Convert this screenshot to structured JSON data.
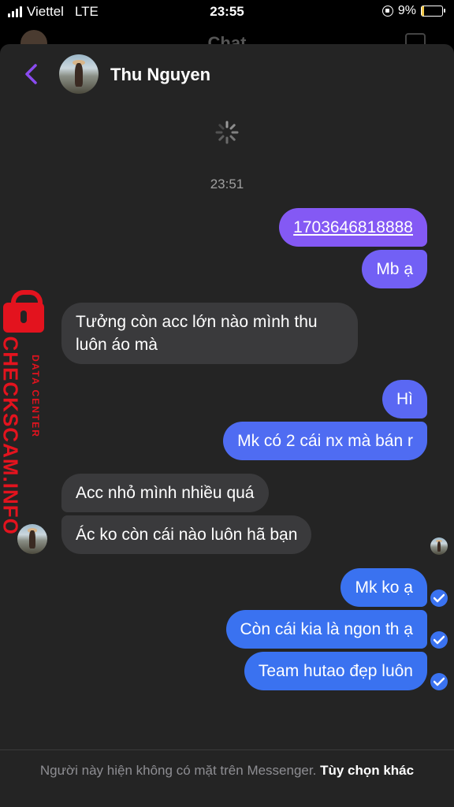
{
  "status_bar": {
    "carrier": "Viettel",
    "network": "LTE",
    "time": "23:55",
    "battery": "9%"
  },
  "underlying": {
    "title": "Chat"
  },
  "header": {
    "contact_name": "Thu Nguyen"
  },
  "conversation": {
    "timestamp": "23:51",
    "messages": [
      {
        "from": "me",
        "text": "1703646818888",
        "link": true
      },
      {
        "from": "me",
        "text": "Mb ạ"
      },
      {
        "from": "them",
        "text_line1": "Tưởng còn acc lớn nào mình thu",
        "text_line2": "luôn áo mà"
      },
      {
        "from": "me",
        "text": "Hì"
      },
      {
        "from": "me",
        "text": "Mk có 2 cái nx mà bán r"
      },
      {
        "from": "them",
        "text": "Acc nhỏ mình nhiều quá"
      },
      {
        "from": "them",
        "text": "Ác ko còn cái nào luôn hã bạn"
      },
      {
        "from": "me",
        "text": "Mk ko ạ"
      },
      {
        "from": "me",
        "text": "Còn cái kia là ngon th ạ"
      },
      {
        "from": "me",
        "text": "Team hutao đẹp luôn"
      }
    ]
  },
  "watermark": {
    "big_text": "CHECKSCAM.INFO",
    "small_text": "DATA CENTER"
  },
  "footer": {
    "notice": "Người này hiện không có mặt trên Messenger.",
    "option": "Tùy chọn khác"
  },
  "colors": {
    "outgoing": "#3a72f0",
    "outgoing_first": "#8459f4",
    "incoming": "#3a3a3c",
    "accent": "#8a4bf0",
    "watermark": "#e3131e"
  }
}
